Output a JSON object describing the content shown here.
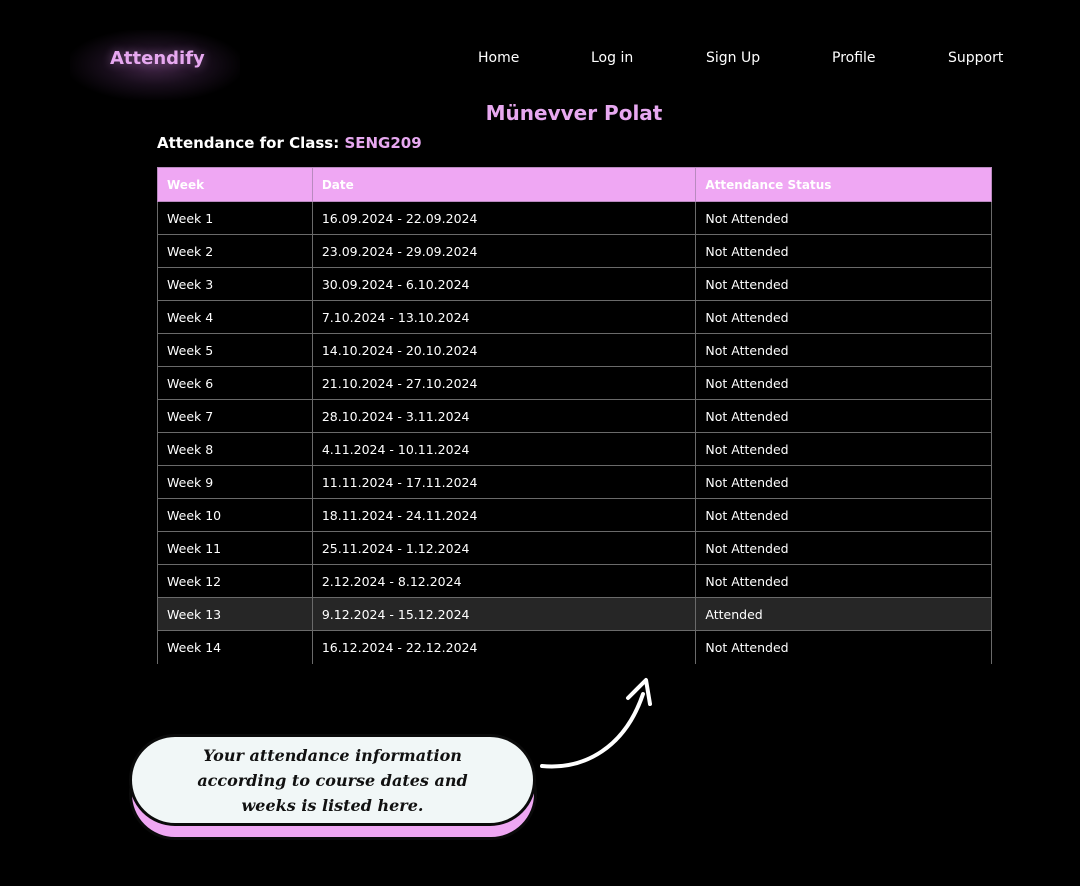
{
  "brand": {
    "logo": "Attendify"
  },
  "nav": {
    "items": [
      {
        "label": "Home"
      },
      {
        "label": "Log in"
      },
      {
        "label": "Sign Up"
      },
      {
        "label": "Profile"
      },
      {
        "label": "Support"
      }
    ]
  },
  "student": {
    "name": "Münevver Polat"
  },
  "class_info": {
    "prefix": "Attendance for Class:",
    "code": "SENG209"
  },
  "table": {
    "headers": [
      "Week",
      "Date",
      "Attendance Status"
    ],
    "rows": [
      {
        "week": "Week 1",
        "date": "16.09.2024 - 22.09.2024",
        "status": "Not Attended"
      },
      {
        "week": "Week 2",
        "date": "23.09.2024 - 29.09.2024",
        "status": "Not Attended"
      },
      {
        "week": "Week 3",
        "date": "30.09.2024 - 6.10.2024",
        "status": "Not Attended"
      },
      {
        "week": "Week 4",
        "date": "7.10.2024 - 13.10.2024",
        "status": "Not Attended"
      },
      {
        "week": "Week 5",
        "date": "14.10.2024 - 20.10.2024",
        "status": "Not Attended"
      },
      {
        "week": "Week 6",
        "date": "21.10.2024 - 27.10.2024",
        "status": "Not Attended"
      },
      {
        "week": "Week 7",
        "date": "28.10.2024 - 3.11.2024",
        "status": "Not Attended"
      },
      {
        "week": "Week 8",
        "date": "4.11.2024 - 10.11.2024",
        "status": "Not Attended"
      },
      {
        "week": "Week 9",
        "date": "11.11.2024 - 17.11.2024",
        "status": "Not Attended"
      },
      {
        "week": "Week 10",
        "date": "18.11.2024 - 24.11.2024",
        "status": "Not Attended"
      },
      {
        "week": "Week 11",
        "date": "25.11.2024 - 1.12.2024",
        "status": "Not Attended"
      },
      {
        "week": "Week 12",
        "date": "2.12.2024 - 8.12.2024",
        "status": "Not Attended"
      },
      {
        "week": "Week 13",
        "date": "9.12.2024 - 15.12.2024",
        "status": "Attended"
      },
      {
        "week": "Week 14",
        "date": "16.12.2024 - 22.12.2024",
        "status": "Not Attended"
      }
    ]
  },
  "callout": {
    "text": "Your attendance information according to course dates and weeks is listed here."
  },
  "colors": {
    "accent": "#efa7f3",
    "accent_text": "#e7a8f0",
    "background": "#000000",
    "highlight_row": "#262626",
    "callout_bg": "#f1f7f7"
  }
}
